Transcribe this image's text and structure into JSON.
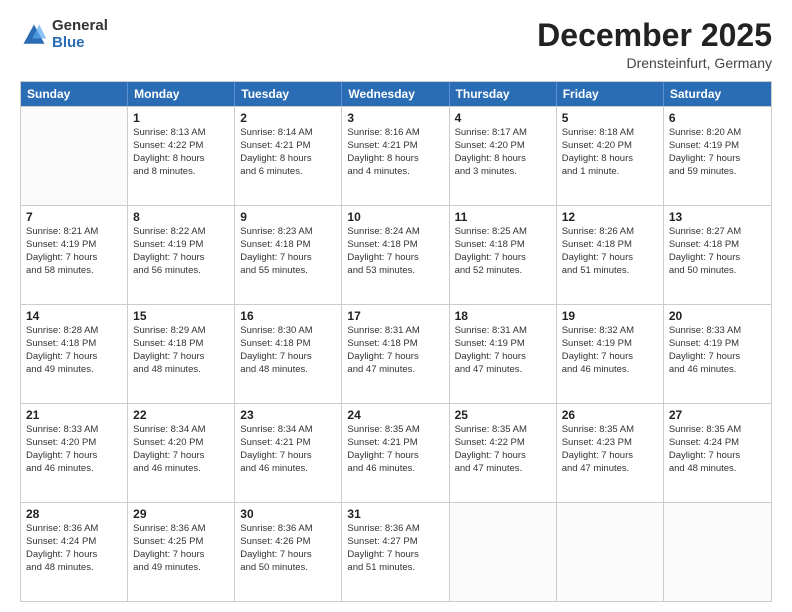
{
  "logo": {
    "general": "General",
    "blue": "Blue"
  },
  "title": {
    "month": "December 2025",
    "location": "Drensteinfurt, Germany"
  },
  "calendar": {
    "headers": [
      "Sunday",
      "Monday",
      "Tuesday",
      "Wednesday",
      "Thursday",
      "Friday",
      "Saturday"
    ],
    "rows": [
      [
        {
          "day": "",
          "info": ""
        },
        {
          "day": "1",
          "info": "Sunrise: 8:13 AM\nSunset: 4:22 PM\nDaylight: 8 hours\nand 8 minutes."
        },
        {
          "day": "2",
          "info": "Sunrise: 8:14 AM\nSunset: 4:21 PM\nDaylight: 8 hours\nand 6 minutes."
        },
        {
          "day": "3",
          "info": "Sunrise: 8:16 AM\nSunset: 4:21 PM\nDaylight: 8 hours\nand 4 minutes."
        },
        {
          "day": "4",
          "info": "Sunrise: 8:17 AM\nSunset: 4:20 PM\nDaylight: 8 hours\nand 3 minutes."
        },
        {
          "day": "5",
          "info": "Sunrise: 8:18 AM\nSunset: 4:20 PM\nDaylight: 8 hours\nand 1 minute."
        },
        {
          "day": "6",
          "info": "Sunrise: 8:20 AM\nSunset: 4:19 PM\nDaylight: 7 hours\nand 59 minutes."
        }
      ],
      [
        {
          "day": "7",
          "info": "Sunrise: 8:21 AM\nSunset: 4:19 PM\nDaylight: 7 hours\nand 58 minutes."
        },
        {
          "day": "8",
          "info": "Sunrise: 8:22 AM\nSunset: 4:19 PM\nDaylight: 7 hours\nand 56 minutes."
        },
        {
          "day": "9",
          "info": "Sunrise: 8:23 AM\nSunset: 4:18 PM\nDaylight: 7 hours\nand 55 minutes."
        },
        {
          "day": "10",
          "info": "Sunrise: 8:24 AM\nSunset: 4:18 PM\nDaylight: 7 hours\nand 53 minutes."
        },
        {
          "day": "11",
          "info": "Sunrise: 8:25 AM\nSunset: 4:18 PM\nDaylight: 7 hours\nand 52 minutes."
        },
        {
          "day": "12",
          "info": "Sunrise: 8:26 AM\nSunset: 4:18 PM\nDaylight: 7 hours\nand 51 minutes."
        },
        {
          "day": "13",
          "info": "Sunrise: 8:27 AM\nSunset: 4:18 PM\nDaylight: 7 hours\nand 50 minutes."
        }
      ],
      [
        {
          "day": "14",
          "info": "Sunrise: 8:28 AM\nSunset: 4:18 PM\nDaylight: 7 hours\nand 49 minutes."
        },
        {
          "day": "15",
          "info": "Sunrise: 8:29 AM\nSunset: 4:18 PM\nDaylight: 7 hours\nand 48 minutes."
        },
        {
          "day": "16",
          "info": "Sunrise: 8:30 AM\nSunset: 4:18 PM\nDaylight: 7 hours\nand 48 minutes."
        },
        {
          "day": "17",
          "info": "Sunrise: 8:31 AM\nSunset: 4:18 PM\nDaylight: 7 hours\nand 47 minutes."
        },
        {
          "day": "18",
          "info": "Sunrise: 8:31 AM\nSunset: 4:19 PM\nDaylight: 7 hours\nand 47 minutes."
        },
        {
          "day": "19",
          "info": "Sunrise: 8:32 AM\nSunset: 4:19 PM\nDaylight: 7 hours\nand 46 minutes."
        },
        {
          "day": "20",
          "info": "Sunrise: 8:33 AM\nSunset: 4:19 PM\nDaylight: 7 hours\nand 46 minutes."
        }
      ],
      [
        {
          "day": "21",
          "info": "Sunrise: 8:33 AM\nSunset: 4:20 PM\nDaylight: 7 hours\nand 46 minutes."
        },
        {
          "day": "22",
          "info": "Sunrise: 8:34 AM\nSunset: 4:20 PM\nDaylight: 7 hours\nand 46 minutes."
        },
        {
          "day": "23",
          "info": "Sunrise: 8:34 AM\nSunset: 4:21 PM\nDaylight: 7 hours\nand 46 minutes."
        },
        {
          "day": "24",
          "info": "Sunrise: 8:35 AM\nSunset: 4:21 PM\nDaylight: 7 hours\nand 46 minutes."
        },
        {
          "day": "25",
          "info": "Sunrise: 8:35 AM\nSunset: 4:22 PM\nDaylight: 7 hours\nand 47 minutes."
        },
        {
          "day": "26",
          "info": "Sunrise: 8:35 AM\nSunset: 4:23 PM\nDaylight: 7 hours\nand 47 minutes."
        },
        {
          "day": "27",
          "info": "Sunrise: 8:35 AM\nSunset: 4:24 PM\nDaylight: 7 hours\nand 48 minutes."
        }
      ],
      [
        {
          "day": "28",
          "info": "Sunrise: 8:36 AM\nSunset: 4:24 PM\nDaylight: 7 hours\nand 48 minutes."
        },
        {
          "day": "29",
          "info": "Sunrise: 8:36 AM\nSunset: 4:25 PM\nDaylight: 7 hours\nand 49 minutes."
        },
        {
          "day": "30",
          "info": "Sunrise: 8:36 AM\nSunset: 4:26 PM\nDaylight: 7 hours\nand 50 minutes."
        },
        {
          "day": "31",
          "info": "Sunrise: 8:36 AM\nSunset: 4:27 PM\nDaylight: 7 hours\nand 51 minutes."
        },
        {
          "day": "",
          "info": ""
        },
        {
          "day": "",
          "info": ""
        },
        {
          "day": "",
          "info": ""
        }
      ]
    ]
  }
}
